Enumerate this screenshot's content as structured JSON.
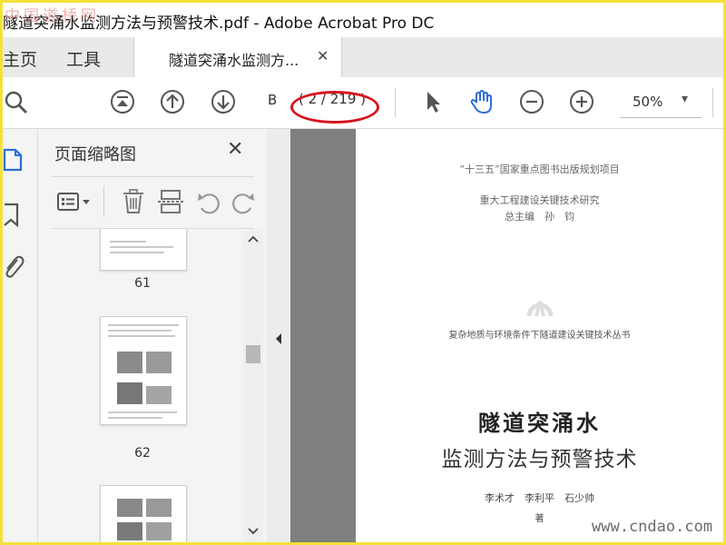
{
  "window": {
    "title": "隧道突涌水监测方法与预警技术.pdf - Adobe Acrobat Pro DC",
    "watermark_top": "中国道桥网"
  },
  "tabs": {
    "home": "主页",
    "tools": "工具",
    "document": "隧道突涌水监测方...",
    "close_glyph": "✕"
  },
  "toolbar": {
    "page_input": "B",
    "page_count": "( 2 / 219 )",
    "zoom_value": "50%",
    "zoom_arrow": "▾"
  },
  "panel": {
    "title": "页面缩略图",
    "close_glyph": "✕",
    "thumbnails": [
      {
        "label": "61"
      },
      {
        "label": "62"
      },
      {
        "label": ""
      }
    ]
  },
  "page": {
    "series_project": "“十三五”国家重点图书出版规划项目",
    "research": "重大工程建设关键技术研究",
    "chief_editor": "总主编　孙　钧",
    "book_series": "复杂地质与环境条件下隧道建设关键技术丛书",
    "title_line1": "隧道突涌水",
    "title_line2": "监测方法与预警技术",
    "authors": "李术才　李利平　石少帅",
    "role": "著"
  },
  "watermark_site": "www.cndao.com",
  "colors": {
    "accent_blue": "#2c6fd6",
    "oval_red": "#d6141c",
    "frame_yellow": "#f5e13a"
  }
}
